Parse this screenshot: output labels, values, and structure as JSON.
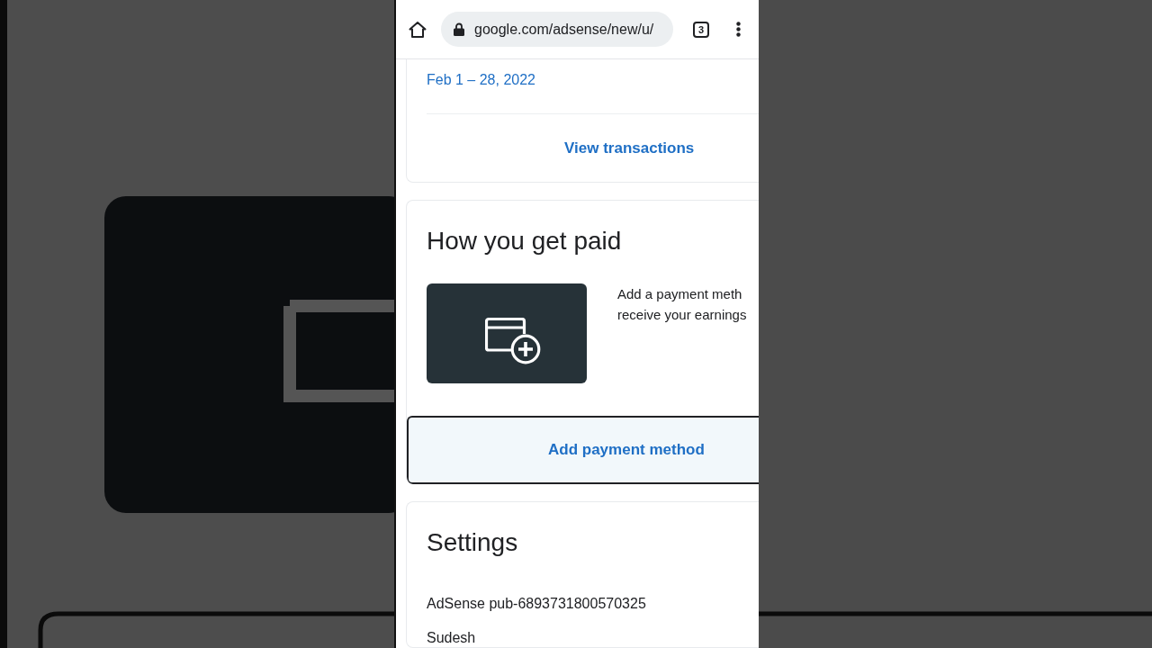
{
  "browser": {
    "url": "google.com/adsense/new/u/",
    "tab_count": "3"
  },
  "transactions_card": {
    "date_range": "Feb 1 – 28, 2022",
    "action": "View transactions"
  },
  "payment_card": {
    "title": "How you get paid",
    "description_lines": [
      "Add a payment meth",
      "receive your earnings"
    ],
    "action": {
      "label": "Add payment method",
      "focused": true
    }
  },
  "settings_card": {
    "title": "Settings",
    "items": [
      "AdSense pub-6893731800570325",
      "Sudesh"
    ]
  }
}
